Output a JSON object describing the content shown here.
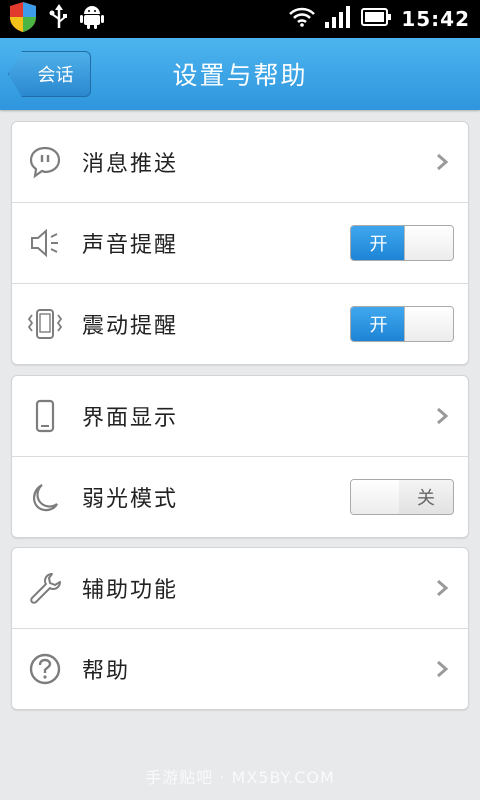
{
  "statusbar": {
    "time": "15:42",
    "icons": [
      "shield-icon",
      "usb-icon",
      "android-icon",
      "wifi-icon",
      "signal-icon",
      "battery-icon"
    ]
  },
  "header": {
    "back_label": "会话",
    "title": "设置与帮助"
  },
  "groups": [
    {
      "items": [
        {
          "label": "消息推送",
          "icon": "message-push-icon",
          "control": "chevron"
        },
        {
          "label": "声音提醒",
          "icon": "speaker-icon",
          "control": "toggle",
          "state": "开"
        },
        {
          "label": "震动提醒",
          "icon": "vibrate-icon",
          "control": "toggle",
          "state": "开"
        }
      ]
    },
    {
      "items": [
        {
          "label": "界面显示",
          "icon": "phone-display-icon",
          "control": "chevron"
        },
        {
          "label": "弱光模式",
          "icon": "moon-icon",
          "control": "toggle",
          "state": "关"
        }
      ]
    },
    {
      "items": [
        {
          "label": "辅助功能",
          "icon": "wrench-icon",
          "control": "chevron"
        },
        {
          "label": "帮助",
          "icon": "help-icon",
          "control": "chevron"
        }
      ]
    }
  ],
  "watermark": "手游贴吧 · MX5BY.COM",
  "colors": {
    "accent": "#2f95dd",
    "toggle_on": "#1d84d6",
    "background": "#e8e9eb"
  }
}
